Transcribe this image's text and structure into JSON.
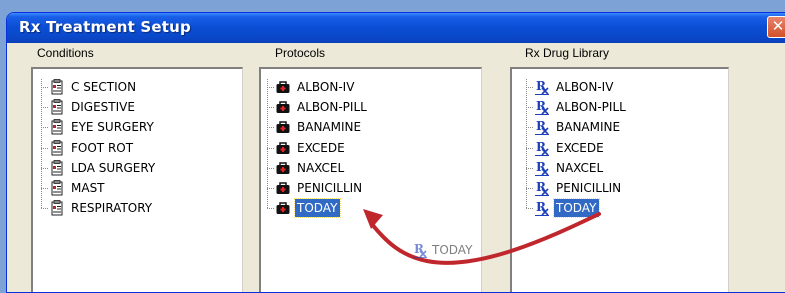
{
  "window": {
    "title": "Rx Treatment Setup",
    "close_symbol": "✕"
  },
  "columns": {
    "conditions": "Conditions",
    "protocols": "Protocols",
    "drugs": "Rx Drug Library"
  },
  "conditions": {
    "icon": "clipboard-rx-icon",
    "items": [
      "C SECTION",
      "DIGESTIVE",
      "EYE SURGERY",
      "FOOT ROT",
      "LDA SURGERY",
      "MAST",
      "RESPIRATORY"
    ]
  },
  "protocols": {
    "icon": "medical-bag-icon",
    "items": [
      "ALBON-IV",
      "ALBON-PILL",
      "BANAMINE",
      "EXCEDE",
      "NAXCEL",
      "PENICILLIN",
      "TODAY"
    ],
    "selected_index": 6
  },
  "drugs": {
    "icon": "rx-symbol-icon",
    "items": [
      "ALBON-IV",
      "ALBON-PILL",
      "BANAMINE",
      "EXCEDE",
      "NAXCEL",
      "PENICILLIN",
      "TODAY"
    ],
    "selected_index": 6
  },
  "drag_ghost": {
    "icon": "rx-symbol-icon",
    "label": "TODAY"
  },
  "colors": {
    "selection": "#316ac5",
    "titlebar": "#0b4fd6",
    "arrow": "#c0272d"
  }
}
